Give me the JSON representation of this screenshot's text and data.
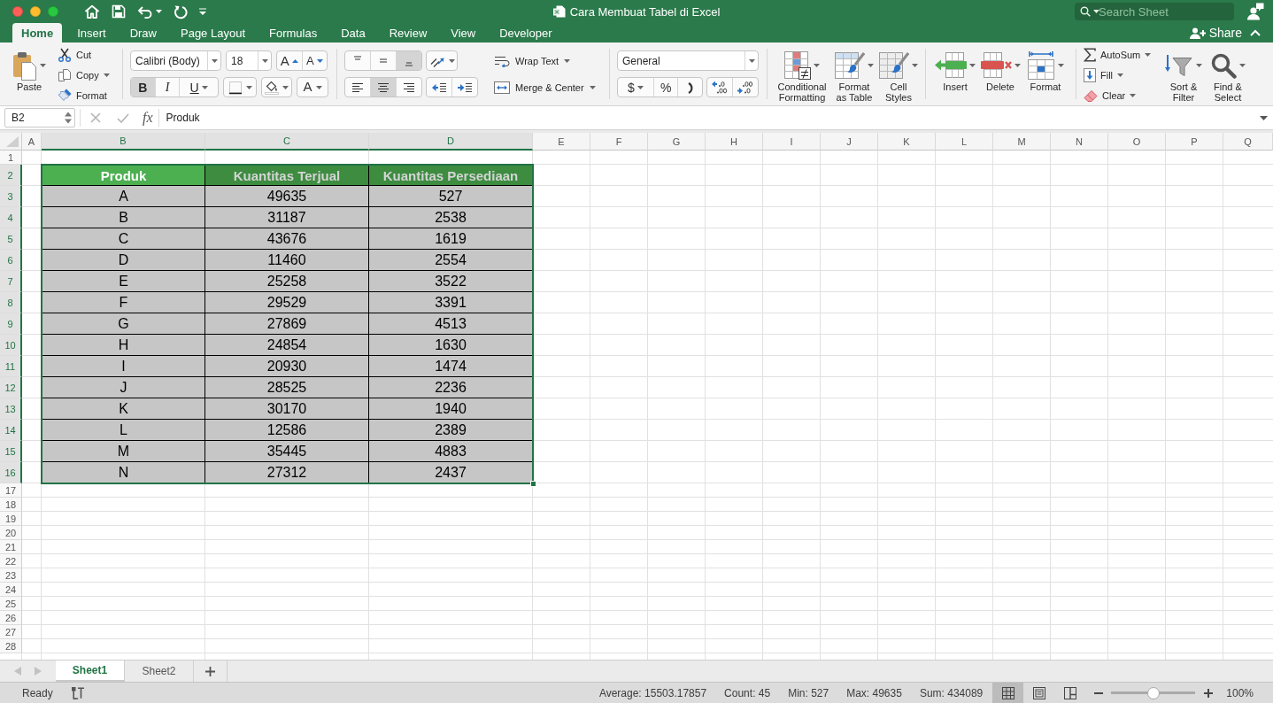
{
  "window": {
    "title": "Cara Membuat Tabel di Excel",
    "search": {
      "placeholder": "Search Sheet"
    }
  },
  "menu_tabs": [
    {
      "label": "Home",
      "selected": true
    },
    {
      "label": "Insert",
      "selected": false
    },
    {
      "label": "Draw",
      "selected": false
    },
    {
      "label": "Page Layout",
      "selected": false
    },
    {
      "label": "Formulas",
      "selected": false
    },
    {
      "label": "Data",
      "selected": false
    },
    {
      "label": "Review",
      "selected": false
    },
    {
      "label": "View",
      "selected": false
    },
    {
      "label": "Developer",
      "selected": false
    }
  ],
  "share": {
    "label": "Share"
  },
  "ribbon": {
    "clipboard": {
      "paste": "Paste",
      "cut": "Cut",
      "copy": "Copy",
      "format_painter": "Format"
    },
    "font": {
      "name": "Calibri (Body)",
      "size": "18",
      "grow": "A",
      "shrink": "A",
      "bold": {
        "label": "B",
        "on": true
      },
      "italic": {
        "label": "I",
        "on": false
      },
      "underline": {
        "label": "U",
        "on": false
      },
      "font_color": "A"
    },
    "alignment": {
      "vertical_align": [
        {
          "selected": false
        },
        {
          "selected": false
        },
        {
          "selected": true
        }
      ],
      "horizontal_align": [
        {
          "selected": false
        },
        {
          "selected": true
        },
        {
          "selected": false
        }
      ],
      "wrap_text": "Wrap Text",
      "merge_center": "Merge & Center"
    },
    "number": {
      "format": "General",
      "currency": "$",
      "percent": "%"
    },
    "styles": {
      "conditional_formatting": "Conditional Formatting",
      "format_as_table": "Format as Table",
      "cell_styles": "Cell Styles"
    },
    "cells": {
      "insert": "Insert",
      "delete": "Delete",
      "format": "Format"
    },
    "editing": {
      "autosum": "AutoSum",
      "fill": "Fill",
      "clear": "Clear",
      "sort_filter": "Sort & Filter",
      "find_select": "Find & Select"
    }
  },
  "formula_bar": {
    "name_box": "B2",
    "function_label": "fx",
    "formula": "Produk"
  },
  "sheet": {
    "columns": [
      {
        "label": "A",
        "selected": false
      },
      {
        "label": "B",
        "selected": true
      },
      {
        "label": "C",
        "selected": true
      },
      {
        "label": "D",
        "selected": true
      },
      {
        "label": "E",
        "selected": false
      },
      {
        "label": "F",
        "selected": false
      },
      {
        "label": "G",
        "selected": false
      },
      {
        "label": "H",
        "selected": false
      },
      {
        "label": "I",
        "selected": false
      },
      {
        "label": "J",
        "selected": false
      },
      {
        "label": "K",
        "selected": false
      },
      {
        "label": "L",
        "selected": false
      },
      {
        "label": "M",
        "selected": false
      },
      {
        "label": "N",
        "selected": false
      },
      {
        "label": "O",
        "selected": false
      },
      {
        "label": "P",
        "selected": false
      },
      {
        "label": "Q",
        "selected": false
      }
    ],
    "rows": [
      {
        "label": "1",
        "selected": false
      },
      {
        "label": "2",
        "selected": true
      },
      {
        "label": "3",
        "selected": true
      },
      {
        "label": "4",
        "selected": true
      },
      {
        "label": "5",
        "selected": true
      },
      {
        "label": "6",
        "selected": true
      },
      {
        "label": "7",
        "selected": true
      },
      {
        "label": "8",
        "selected": true
      },
      {
        "label": "9",
        "selected": true
      },
      {
        "label": "10",
        "selected": true
      },
      {
        "label": "11",
        "selected": true
      },
      {
        "label": "12",
        "selected": true
      },
      {
        "label": "13",
        "selected": true
      },
      {
        "label": "14",
        "selected": true
      },
      {
        "label": "15",
        "selected": true
      },
      {
        "label": "16",
        "selected": true
      },
      {
        "label": "17",
        "selected": false
      },
      {
        "label": "18",
        "selected": false
      },
      {
        "label": "19",
        "selected": false
      },
      {
        "label": "20",
        "selected": false
      },
      {
        "label": "21",
        "selected": false
      },
      {
        "label": "22",
        "selected": false
      },
      {
        "label": "23",
        "selected": false
      },
      {
        "label": "24",
        "selected": false
      },
      {
        "label": "25",
        "selected": false
      },
      {
        "label": "26",
        "selected": false
      },
      {
        "label": "27",
        "selected": false
      },
      {
        "label": "28",
        "selected": false
      }
    ],
    "table": {
      "selected": true,
      "header": [
        {
          "text": "Produk",
          "active": true
        },
        {
          "text": "Kuantitas Terjual",
          "active": false
        },
        {
          "text": "Kuantitas Persediaan",
          "active": false
        }
      ],
      "rows": [
        [
          "A",
          "49635",
          "527"
        ],
        [
          "B",
          "31187",
          "2538"
        ],
        [
          "C",
          "43676",
          "1619"
        ],
        [
          "D",
          "11460",
          "2554"
        ],
        [
          "E",
          "25258",
          "3522"
        ],
        [
          "F",
          "29529",
          "3391"
        ],
        [
          "G",
          "27869",
          "4513"
        ],
        [
          "H",
          "24854",
          "1630"
        ],
        [
          "I",
          "20930",
          "1474"
        ],
        [
          "J",
          "28525",
          "2236"
        ],
        [
          "K",
          "30170",
          "1940"
        ],
        [
          "L",
          "12586",
          "2389"
        ],
        [
          "M",
          "35445",
          "4883"
        ],
        [
          "N",
          "27312",
          "2437"
        ]
      ]
    }
  },
  "sheet_tabs": [
    {
      "label": "Sheet1",
      "selected": true
    },
    {
      "label": "Sheet2",
      "selected": false
    }
  ],
  "status_bar": {
    "mode": "Ready",
    "stats": [
      "Average: 15503.17857",
      "Count: 45",
      "Min: 527",
      "Max: 49635",
      "Sum: 434089"
    ],
    "views": [
      {
        "selected": true
      },
      {
        "selected": false
      },
      {
        "selected": false
      }
    ],
    "zoom": {
      "level": 0.5,
      "reading": "100%"
    }
  }
}
